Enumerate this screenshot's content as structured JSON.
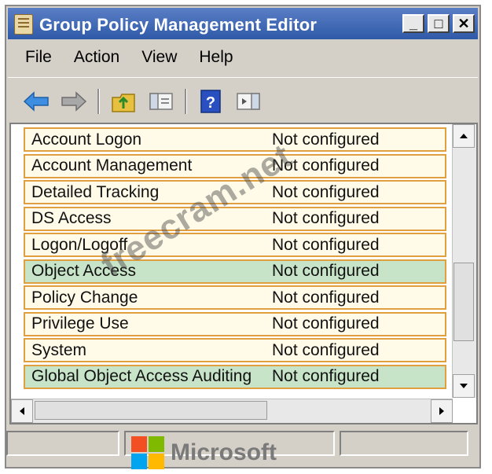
{
  "window": {
    "title": "Group Policy Management Editor"
  },
  "window_buttons": {
    "minimize": "_",
    "maximize": "□",
    "close": "✕"
  },
  "menu": [
    {
      "label": "File"
    },
    {
      "label": "Action"
    },
    {
      "label": "View"
    },
    {
      "label": "Help"
    }
  ],
  "toolbar": {
    "icons": [
      "back-arrow-icon",
      "forward-arrow-icon",
      "up-folder-icon",
      "show-hide-pane-icon",
      "help-icon",
      "action-pane-icon"
    ]
  },
  "list": {
    "rows": [
      {
        "name": "Account Logon",
        "value": "Not configured",
        "highlighted": false
      },
      {
        "name": "Account Management",
        "value": "Not configured",
        "highlighted": false
      },
      {
        "name": "Detailed Tracking",
        "value": "Not configured",
        "highlighted": false
      },
      {
        "name": "DS Access",
        "value": "Not configured",
        "highlighted": false
      },
      {
        "name": "Logon/Logoff",
        "value": "Not configured",
        "highlighted": false
      },
      {
        "name": "Object Access",
        "value": "Not configured",
        "highlighted": true
      },
      {
        "name": "Policy Change",
        "value": "Not configured",
        "highlighted": false
      },
      {
        "name": "Privilege Use",
        "value": "Not configured",
        "highlighted": false
      },
      {
        "name": "System",
        "value": "Not configured",
        "highlighted": false
      },
      {
        "name": "Global Object Access Auditing",
        "value": "Not configured",
        "highlighted": true
      }
    ]
  },
  "watermark": "freecram.net",
  "brand": {
    "text": "Microsoft",
    "colors": [
      "#f25022",
      "#7fba00",
      "#00a4ef",
      "#ffb900"
    ]
  },
  "colors": {
    "title_bar": "#3c64b4",
    "row_border": "#e0a040",
    "row_highlight": "#c8e4c8"
  }
}
